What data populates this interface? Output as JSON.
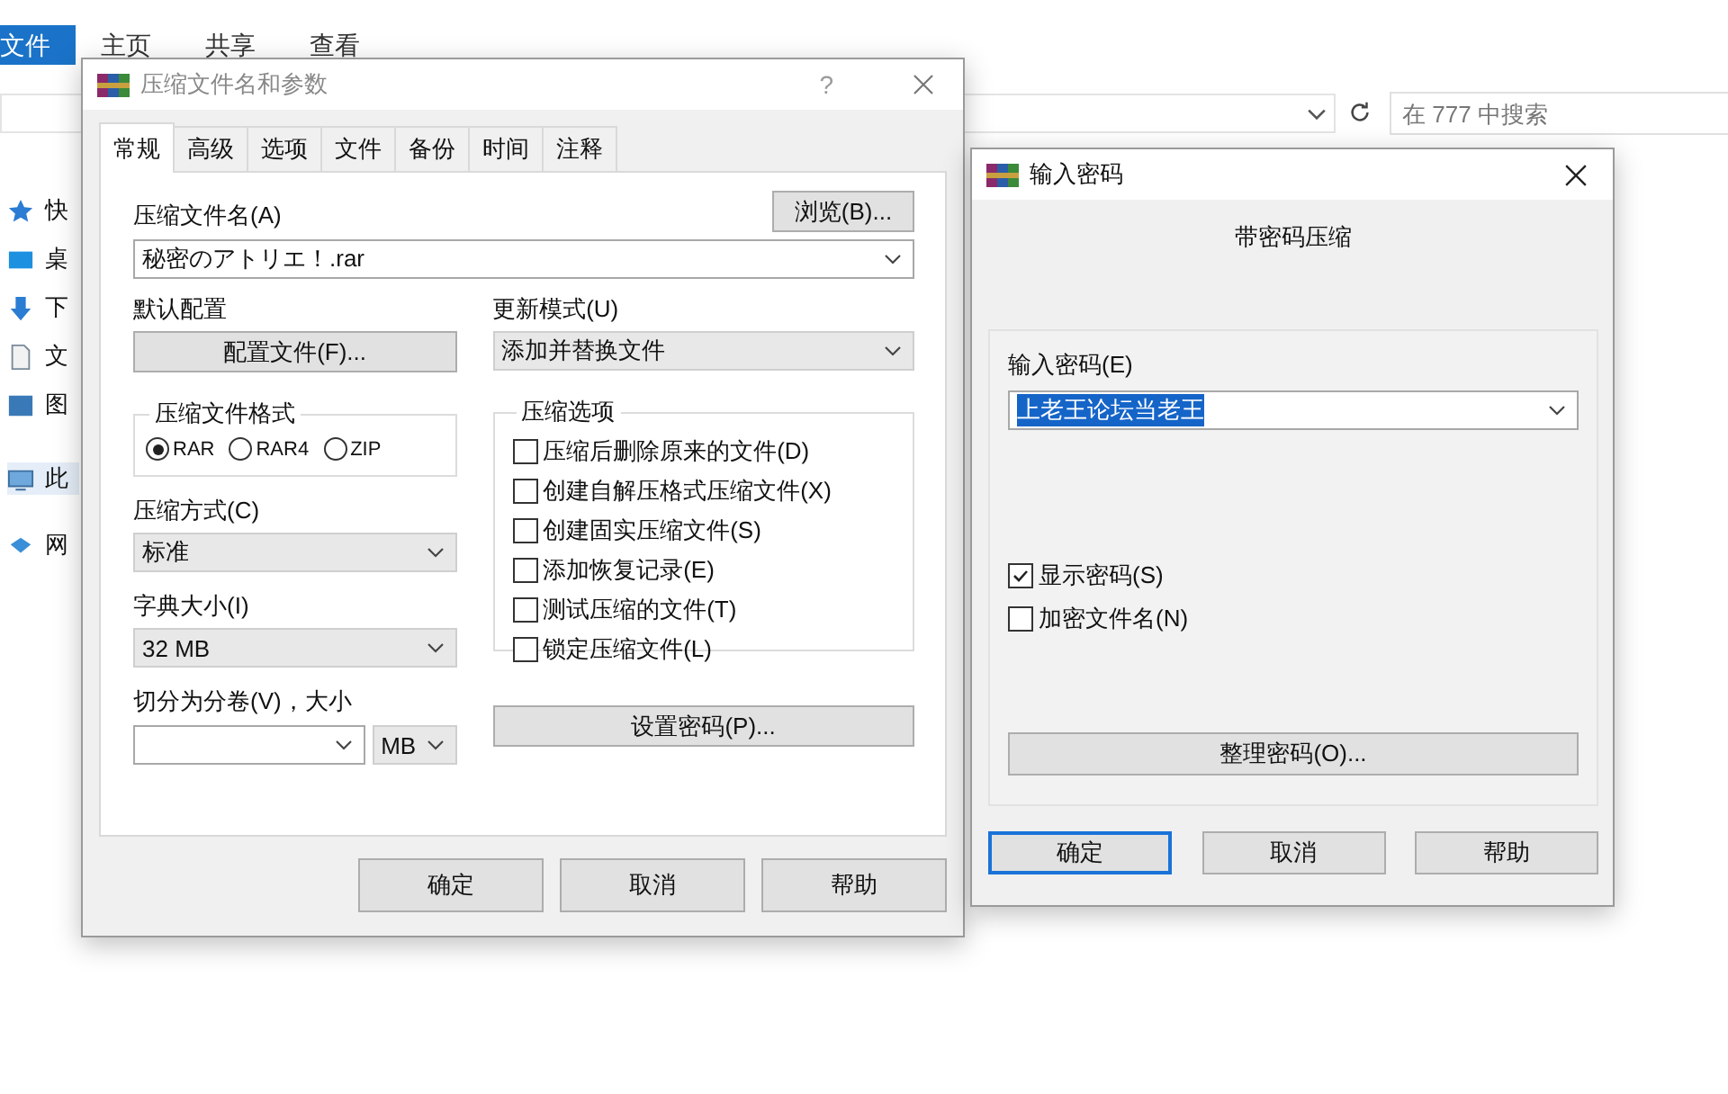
{
  "explorer": {
    "ribbon_tabs": [
      {
        "label": "文件",
        "selected": true
      },
      {
        "label": "主页",
        "selected": false
      },
      {
        "label": "共享",
        "selected": false
      },
      {
        "label": "查看",
        "selected": false
      }
    ],
    "search": {
      "placeholder": "在 777 中搜索"
    },
    "sidebar": {
      "items": [
        {
          "label": "快",
          "kind": "star",
          "selected": false
        },
        {
          "label": "桌",
          "kind": "desktop",
          "selected": false
        },
        {
          "label": "下",
          "kind": "download",
          "selected": false
        },
        {
          "label": "文",
          "kind": "document",
          "selected": false
        },
        {
          "label": "图",
          "kind": "picture",
          "selected": false
        },
        {
          "label": "此",
          "kind": "pc",
          "selected": true
        },
        {
          "label": "网",
          "kind": "network",
          "selected": false
        }
      ]
    }
  },
  "archive_dialog": {
    "title": "压缩文件名和参数",
    "help": "?",
    "tabs": [
      {
        "label": "常规",
        "selected": true
      },
      {
        "label": "高级",
        "selected": false
      },
      {
        "label": "选项",
        "selected": false
      },
      {
        "label": "文件",
        "selected": false
      },
      {
        "label": "备份",
        "selected": false
      },
      {
        "label": "时间",
        "selected": false
      },
      {
        "label": "注释",
        "selected": false
      }
    ],
    "archive_name_label": "压缩文件名(A)",
    "browse_button": "浏览(B)...",
    "archive_name": "秘密のアトリエ！.rar",
    "profile_label": "默认配置",
    "profile_button": "配置文件(F)...",
    "update_mode_label": "更新模式(U)",
    "update_mode": "添加并替换文件",
    "format_group": {
      "title": "压缩文件格式",
      "options": [
        {
          "label": "RAR",
          "selected": true
        },
        {
          "label": "RAR4",
          "selected": false
        },
        {
          "label": "ZIP",
          "selected": false
        }
      ]
    },
    "options_group": {
      "title": "压缩选项",
      "options": [
        {
          "label": "压缩后删除原来的文件(D)",
          "checked": false
        },
        {
          "label": "创建自解压格式压缩文件(X)",
          "checked": false
        },
        {
          "label": "创建固实压缩文件(S)",
          "checked": false
        },
        {
          "label": "添加恢复记录(E)",
          "checked": false
        },
        {
          "label": "测试压缩的文件(T)",
          "checked": false
        },
        {
          "label": "锁定压缩文件(L)",
          "checked": false
        }
      ]
    },
    "method_label": "压缩方式(C)",
    "method": "标准",
    "dictionary_label": "字典大小(I)",
    "dictionary": "32 MB",
    "split_label": "切分为分卷(V)，大小",
    "split_unit": "MB",
    "password_button": "设置密码(P)...",
    "buttons": [
      {
        "label": "确定",
        "focused": false
      },
      {
        "label": "取消",
        "focused": false
      },
      {
        "label": "帮助",
        "focused": false
      }
    ]
  },
  "password_dialog": {
    "title": "输入密码",
    "heading": "带密码压缩",
    "password_label": "输入密码(E)",
    "password": "上老王论坛当老王",
    "options": [
      {
        "label": "显示密码(S)",
        "checked": true
      },
      {
        "label": "加密文件名(N)",
        "checked": false
      }
    ],
    "organize_button": "整理密码(O)...",
    "buttons": [
      {
        "label": "确定",
        "focused": true
      },
      {
        "label": "取消",
        "focused": false
      },
      {
        "label": "帮助",
        "focused": false
      }
    ]
  }
}
